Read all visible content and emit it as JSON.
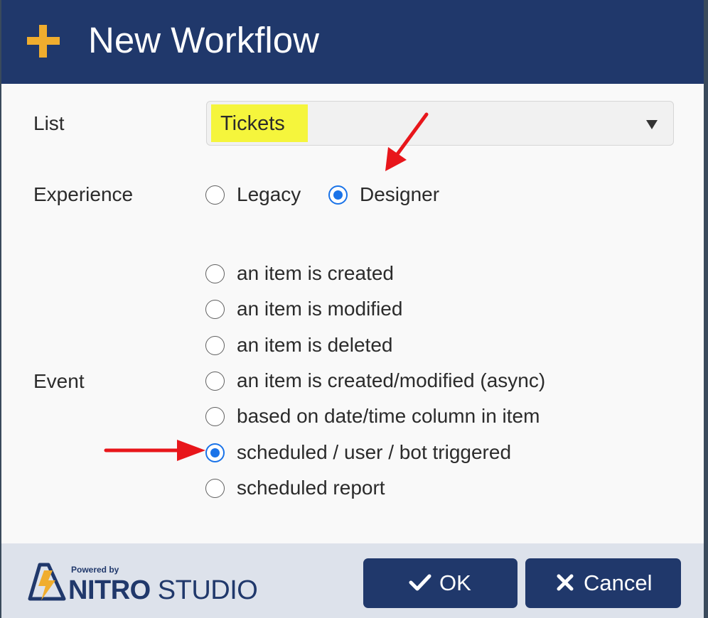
{
  "dialog": {
    "title": "New Workflow",
    "title_icon": "plus-icon"
  },
  "list": {
    "label": "List",
    "value": "Tickets"
  },
  "experience": {
    "label": "Experience",
    "options": [
      {
        "label": "Legacy",
        "selected": false
      },
      {
        "label": "Designer",
        "selected": true
      }
    ]
  },
  "event": {
    "label": "Event",
    "options": [
      {
        "label": "an item is created",
        "selected": false
      },
      {
        "label": "an item is modified",
        "selected": false
      },
      {
        "label": "an item is deleted",
        "selected": false
      },
      {
        "label": "an item is created/modified (async)",
        "selected": false
      },
      {
        "label": "based on date/time column in item",
        "selected": false
      },
      {
        "label": "scheduled / user / bot triggered",
        "selected": true
      },
      {
        "label": "scheduled report",
        "selected": false
      }
    ]
  },
  "footer": {
    "logo": {
      "powered_by": "Powered by",
      "brand_bold": "NITRO",
      "brand_light": "STUDIO"
    },
    "ok_label": "OK",
    "cancel_label": "Cancel"
  },
  "colors": {
    "header_bg": "#20386b",
    "accent_plus": "#f0ad2e",
    "radio_selected": "#1a73e8",
    "highlight": "#f5f53c",
    "annotation_arrow": "#e8161b",
    "footer_bg": "#dde2eb"
  }
}
